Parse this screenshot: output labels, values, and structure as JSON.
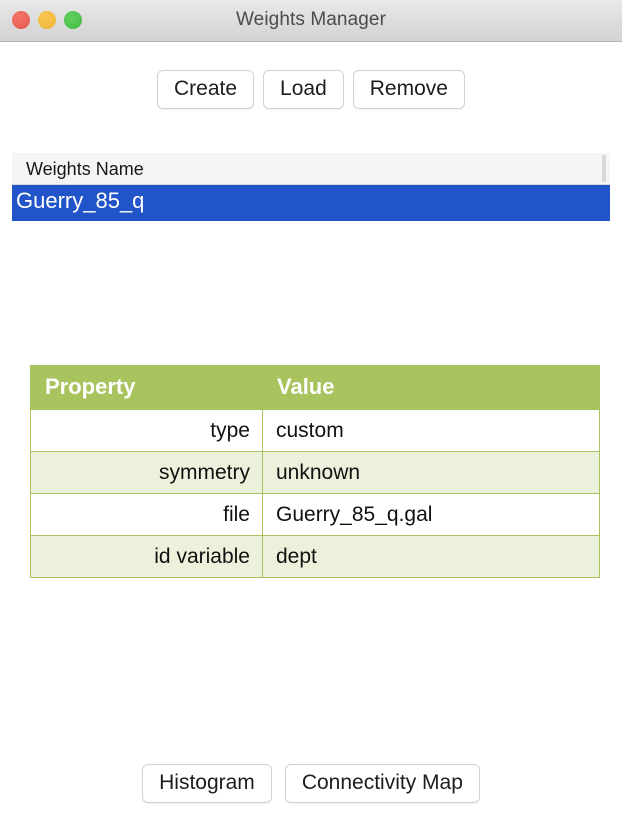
{
  "window": {
    "title": "Weights Manager",
    "traffic_lights": [
      {
        "name": "close",
        "color": "#ec6459"
      },
      {
        "name": "minimize",
        "color": "#f3bc41"
      },
      {
        "name": "maximize",
        "color": "#4ec44d"
      }
    ]
  },
  "toolbar": {
    "buttons": [
      {
        "label": "Create"
      },
      {
        "label": "Load"
      },
      {
        "label": "Remove"
      }
    ]
  },
  "weights_list": {
    "column_header": "Weights Name",
    "rows": [
      {
        "name": "Guerry_85_q",
        "selected": true
      }
    ],
    "selection_color": "#2054c8"
  },
  "properties_table": {
    "headers": [
      "Property",
      "Value"
    ],
    "header_bg": "#a9c35e",
    "alt_row_bg": "#ecf1db",
    "rows": [
      {
        "property": "type",
        "value": "custom"
      },
      {
        "property": "symmetry",
        "value": "unknown"
      },
      {
        "property": "file",
        "value": "Guerry_85_q.gal"
      },
      {
        "property": "id variable",
        "value": "dept"
      }
    ]
  },
  "bottom_bar": {
    "buttons": [
      {
        "label": "Histogram"
      },
      {
        "label": "Connectivity Map"
      }
    ]
  }
}
